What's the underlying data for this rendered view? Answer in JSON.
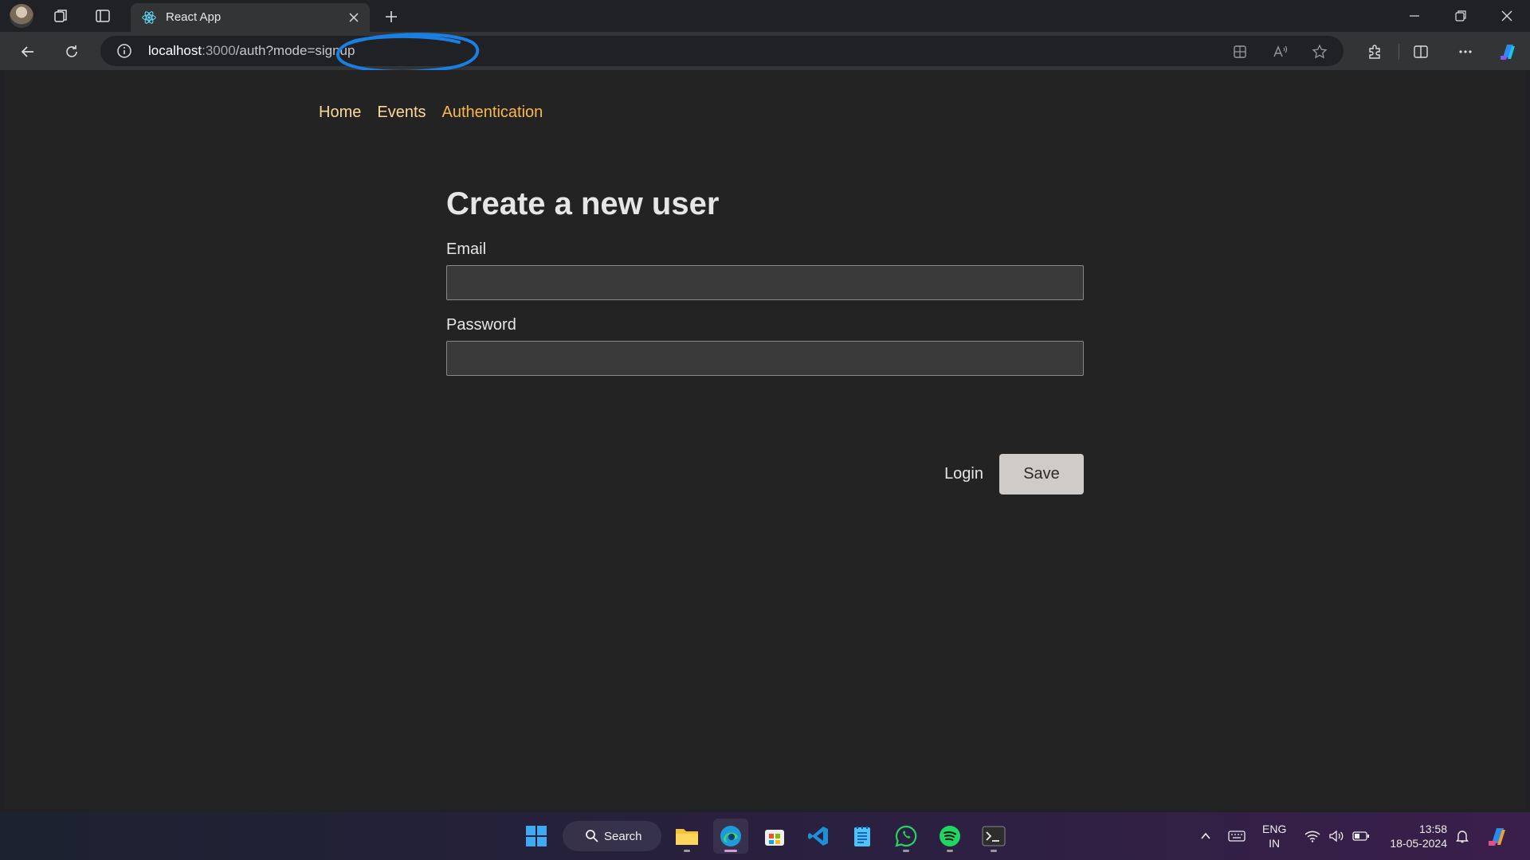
{
  "browser": {
    "tab": {
      "title": "React App"
    },
    "address_bar": {
      "url_host": "localhost",
      "url_port": ":3000",
      "url_path": "/auth?mode=signup",
      "annotation_color": "#1a7fe0"
    }
  },
  "nav": {
    "items": [
      {
        "label": "Home",
        "active": false
      },
      {
        "label": "Events",
        "active": false
      },
      {
        "label": "Authentication",
        "active": true
      }
    ],
    "link_color": "#fcd997",
    "active_color": "#f7b84a"
  },
  "form": {
    "title": "Create a new user",
    "email": {
      "label": "Email",
      "value": "",
      "placeholder": ""
    },
    "password": {
      "label": "Password",
      "value": "",
      "placeholder": ""
    },
    "toggle_link": "Login",
    "submit_label": "Save"
  },
  "taskbar": {
    "search_label": "Search",
    "apps": [
      "file-explorer",
      "edge",
      "microsoft-store",
      "vscode",
      "notepad",
      "whatsapp",
      "spotify",
      "terminal"
    ],
    "active_app": "edge",
    "lang_line1": "ENG",
    "lang_line2": "IN",
    "time": "13:58",
    "date": "18-05-2024"
  }
}
